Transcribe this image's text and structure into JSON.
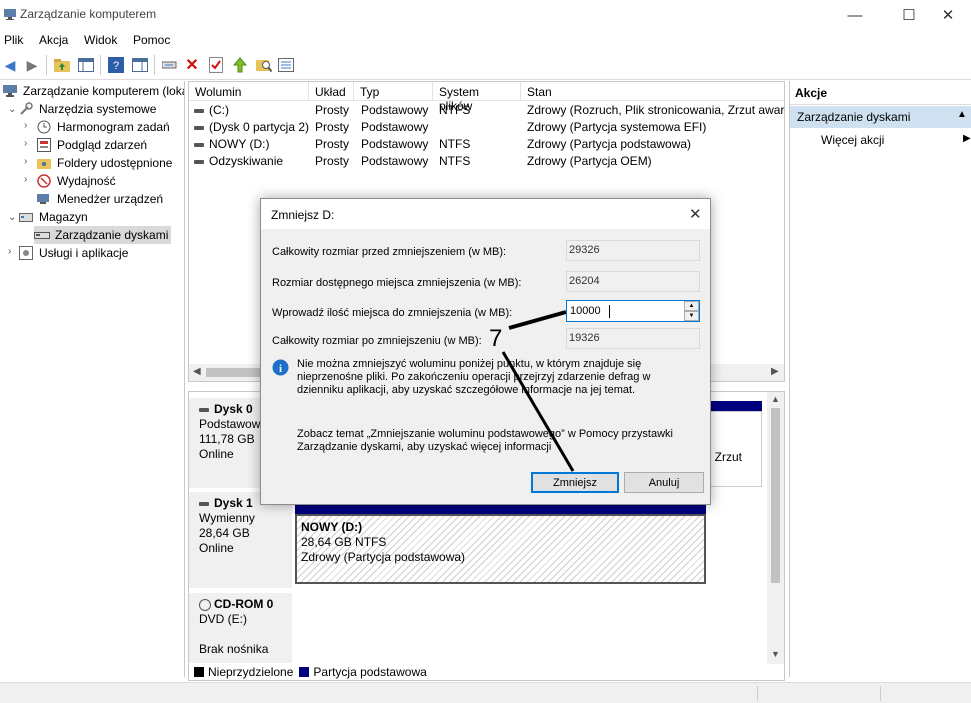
{
  "window": {
    "title": "Zarządzanie komputerem",
    "controls": [
      "—",
      "☐",
      "✕"
    ]
  },
  "menu": [
    "Plik",
    "Akcja",
    "Widok",
    "Pomoc"
  ],
  "tree": {
    "root": "Zarządzanie komputerem (loka",
    "items": [
      "Narzędzia systemowe",
      "Harmonogram zadań",
      "Podgląd zdarzeń",
      "Foldery udostępnione",
      "Wydajność",
      "Menedżer urządzeń",
      "Magazyn",
      "Zarządzanie dyskami",
      "Usługi i aplikacje"
    ]
  },
  "volumes": {
    "headers": [
      "Wolumin",
      "Układ",
      "Typ",
      "System plików",
      "Stan"
    ],
    "rows": [
      [
        "(C:)",
        "Prosty",
        "Podstawowy",
        "NTFS",
        "Zdrowy (Rozruch, Plik stronicowania, Zrzut awary"
      ],
      [
        "(Dysk 0 partycja 2)",
        "Prosty",
        "Podstawowy",
        "",
        "Zdrowy (Partycja systemowa EFI)"
      ],
      [
        "NOWY (D:)",
        "Prosty",
        "Podstawowy",
        "NTFS",
        "Zdrowy (Partycja podstawowa)"
      ],
      [
        "Odzyskiwanie",
        "Prosty",
        "Podstawowy",
        "NTFS",
        "Zdrowy (Partycja OEM)"
      ]
    ]
  },
  "disks": {
    "d0": {
      "name": "Dysk 0",
      "type": "Podstawowy",
      "size": "111,78 GB",
      "status": "Online",
      "partial": ", Zrzut"
    },
    "d1": {
      "name": "Dysk 1",
      "type": "Wymienny",
      "size": "28,64 GB",
      "status": "Online",
      "vol_name": "NOWY  (D:)",
      "vol_size": "28,64 GB NTFS",
      "vol_status": "Zdrowy (Partycja podstawowa)"
    },
    "cd": {
      "name": "CD-ROM 0",
      "type": "DVD (E:)",
      "status": "Brak nośnika"
    }
  },
  "legend": {
    "unallocated": "Nieprzydzielone",
    "primary": "Partycja podstawowa"
  },
  "actions": {
    "header": "Akcje",
    "section": "Zarządzanie dyskami",
    "more": "Więcej akcji"
  },
  "dialog": {
    "title": "Zmniejsz D:",
    "total_label": "Całkowity rozmiar przed zmniejszeniem (w MB):",
    "total_value": "29326",
    "avail_label": "Rozmiar dostępnego miejsca zmniejszenia (w MB):",
    "avail_value": "26204",
    "enter_label": "Wprowadź ilość miejsca do zmniejszenia (w MB):",
    "enter_value": "10000",
    "after_label": "Całkowity rozmiar po zmniejszeniu (w MB):",
    "after_value": "19326",
    "info": "Nie można zmniejszyć woluminu poniżej punktu, w którym znajduje się nieprzenośne pliki. Po zakończeniu operacji przejrzyj zdarzenie defrag w dzienniku aplikacji, aby uzyskać szczegółowe informacje na jej temat.",
    "help": "Zobacz temat „Zmniejszanie woluminu podstawowego” w Pomocy przystawki Zarządzanie dyskami, aby uzyskać więcej informacji",
    "ok": "Zmniejsz",
    "cancel": "Anuluj"
  },
  "annotation": {
    "number": "7"
  },
  "colors": {
    "primary_partition": "#00007f",
    "unallocated": "#000000",
    "selected": "#cce4f7"
  }
}
